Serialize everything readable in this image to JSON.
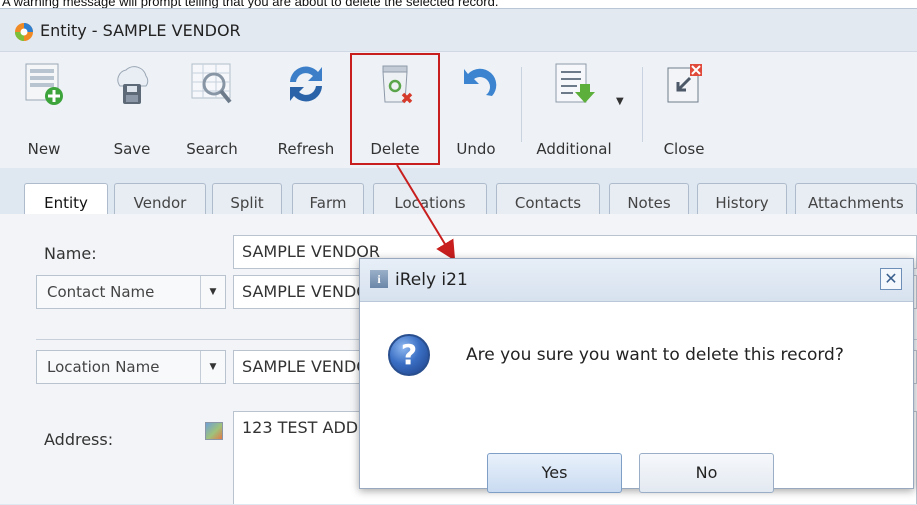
{
  "caption": "A warning message will prompt telling that you are about to delete the selected record.",
  "window": {
    "title": "Entity - SAMPLE VENDOR"
  },
  "toolbar": {
    "new": "New",
    "save": "Save",
    "search": "Search",
    "refresh": "Refresh",
    "delete": "Delete",
    "undo": "Undo",
    "additional": "Additional",
    "close": "Close"
  },
  "tabs": [
    "Entity",
    "Vendor",
    "Split",
    "Farm",
    "Locations",
    "Contacts",
    "Notes",
    "History",
    "Attachments"
  ],
  "form": {
    "name_label": "Name:",
    "name_value": "SAMPLE VENDOR",
    "contact_name_label": "Contact Name",
    "contact_name_value": "SAMPLE VENDOR",
    "location_name_label": "Location Name",
    "location_name_value": "SAMPLE VENDOR",
    "address_label": "Address:",
    "address_value": "123 TEST ADDRESS"
  },
  "dialog": {
    "title": "iRely i21",
    "message": "Are you sure you want to delete this record?",
    "yes": "Yes",
    "no": "No"
  },
  "colors": {
    "highlight": "#c81e1e",
    "window_bg": "#dfe7f1"
  }
}
